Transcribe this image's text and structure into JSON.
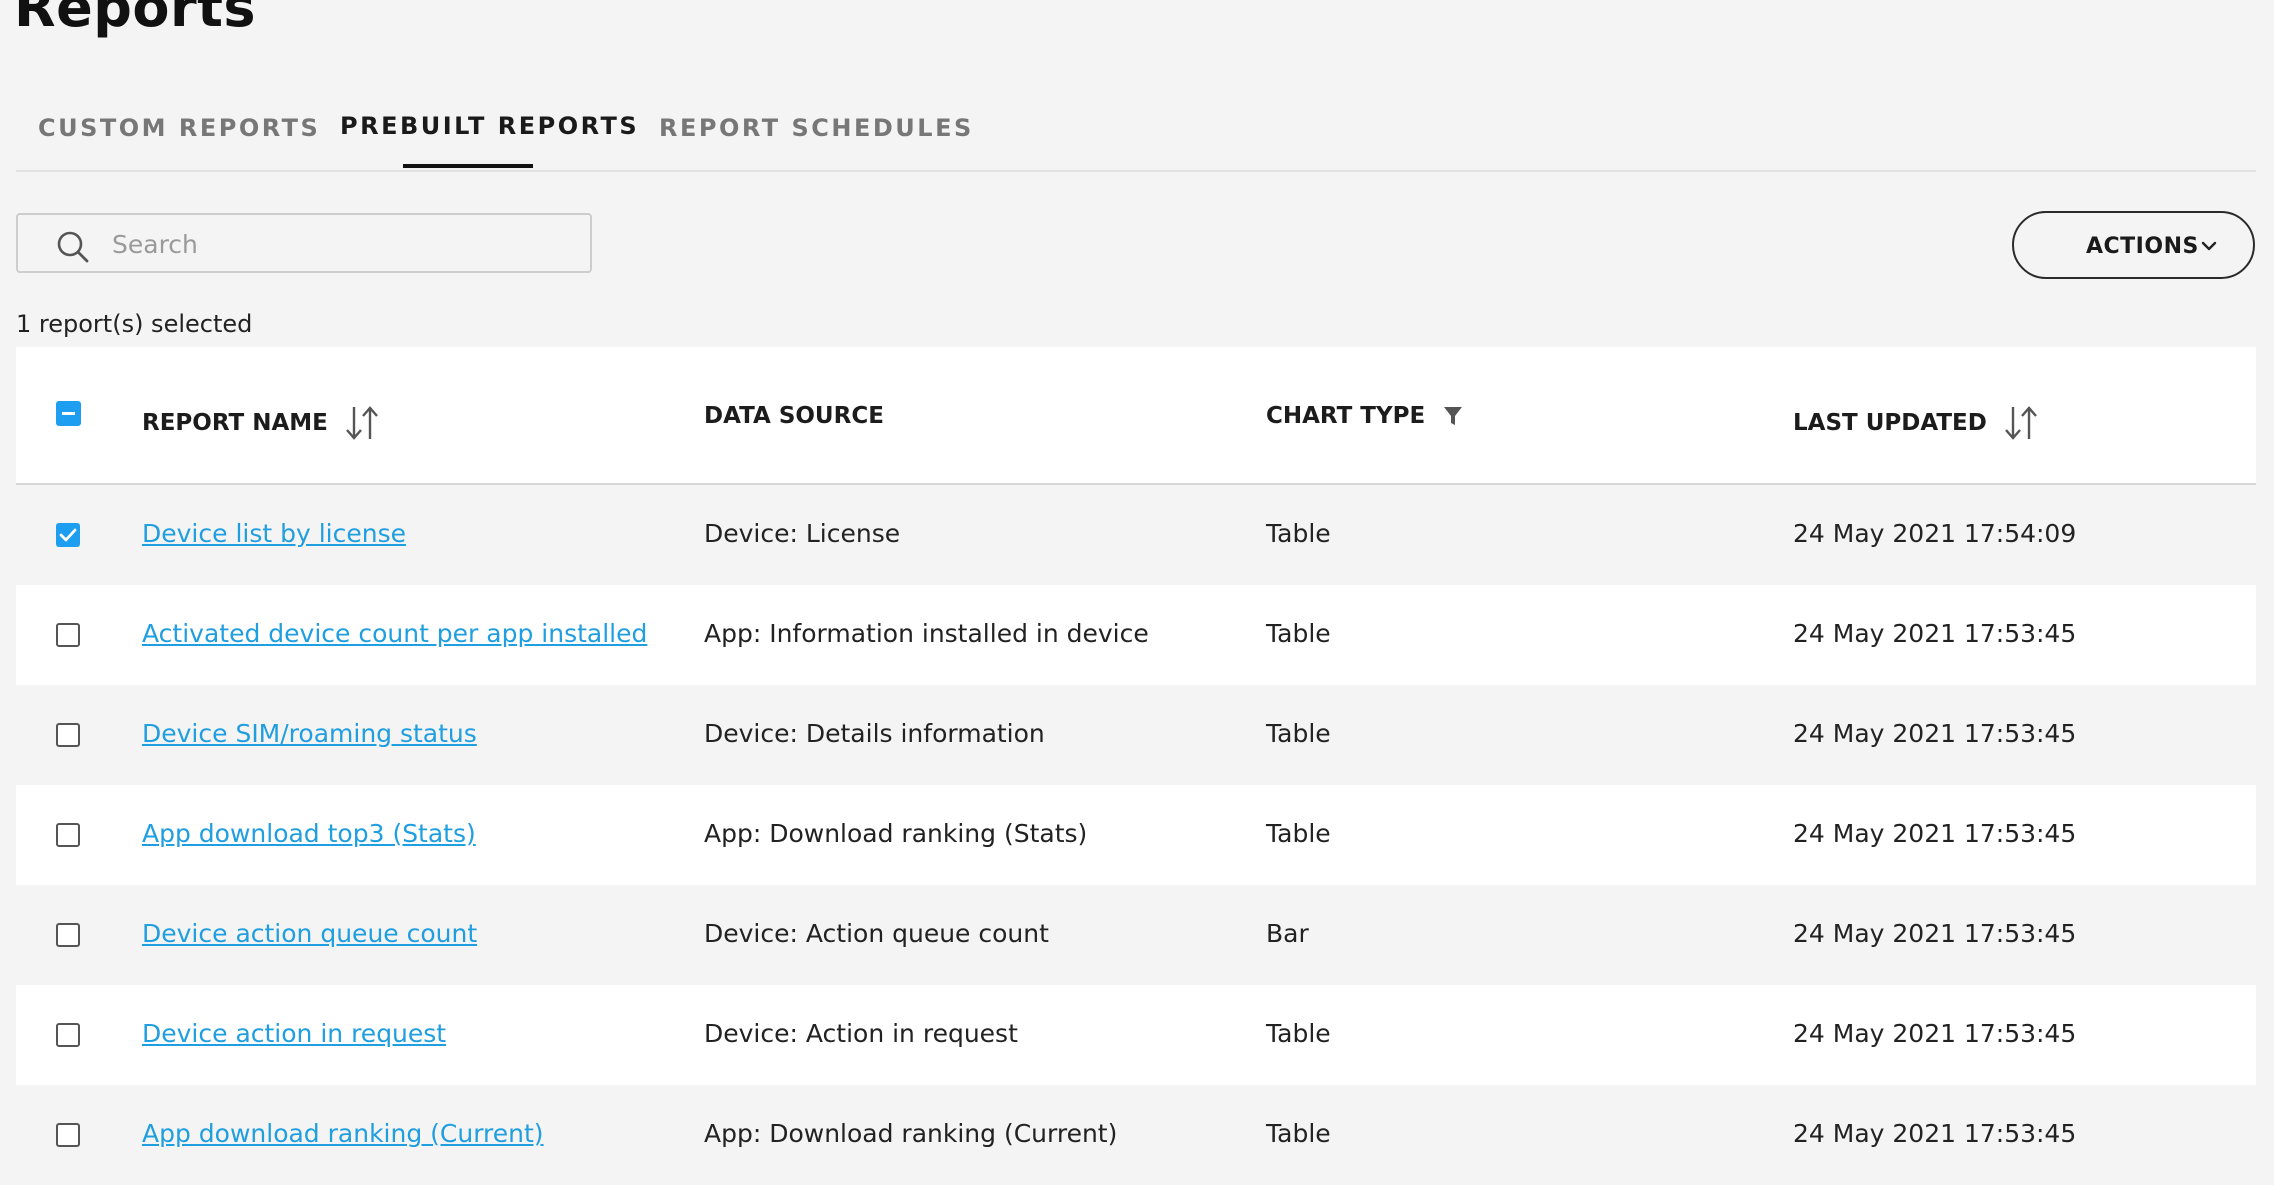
{
  "page": {
    "title": "Reports"
  },
  "tabs": [
    {
      "label": "CUSTOM REPORTS",
      "active": false
    },
    {
      "label": "PREBUILT REPORTS",
      "active": true
    },
    {
      "label": "REPORT SCHEDULES",
      "active": false
    }
  ],
  "search": {
    "placeholder": "Search",
    "value": ""
  },
  "actions": {
    "label": "ACTIONS"
  },
  "selection": {
    "status": "1 report(s) selected"
  },
  "table": {
    "columns": {
      "name": "REPORT NAME",
      "source": "DATA SOURCE",
      "chart": "CHART TYPE",
      "updated": "LAST UPDATED"
    },
    "rows": [
      {
        "checked": true,
        "name": "Device list by license",
        "source": "Device: License",
        "chart": "Table",
        "updated": "24 May 2021 17:54:09"
      },
      {
        "checked": false,
        "name": "Activated device count per app installed",
        "source": "App: Information installed in device",
        "chart": "Table",
        "updated": "24 May 2021 17:53:45"
      },
      {
        "checked": false,
        "name": "Device SIM/roaming status",
        "source": "Device: Details information",
        "chart": "Table",
        "updated": "24 May 2021 17:53:45"
      },
      {
        "checked": false,
        "name": "App download top3 (Stats)",
        "source": "App: Download ranking (Stats)",
        "chart": "Table",
        "updated": "24 May 2021 17:53:45"
      },
      {
        "checked": false,
        "name": "Device action queue count",
        "source": "Device: Action queue count",
        "chart": "Bar",
        "updated": "24 May 2021 17:53:45"
      },
      {
        "checked": false,
        "name": "Device action in request",
        "source": "Device: Action in request",
        "chart": "Table",
        "updated": "24 May 2021 17:53:45"
      },
      {
        "checked": false,
        "name": "App download ranking (Current)",
        "source": "App: Download ranking (Current)",
        "chart": "Table",
        "updated": "24 May 2021 17:53:45"
      }
    ]
  },
  "colors": {
    "accent": "#1e9ef0",
    "link": "#1f9ee0",
    "background": "#f4f4f4"
  },
  "icons": {
    "search": "search-icon",
    "sort": "sort-icon",
    "filter": "filter-icon",
    "chevron": "chevron-down-icon"
  }
}
